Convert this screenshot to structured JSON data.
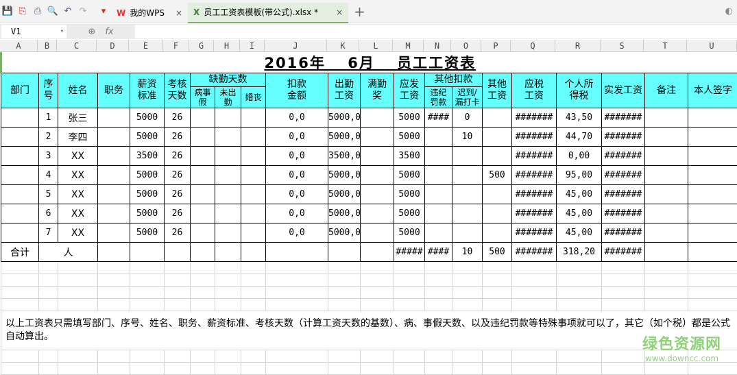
{
  "toolbar": {
    "tabs": [
      {
        "label": "我的WPS"
      },
      {
        "label": "员工工资表模板(带公式).xlsx *"
      }
    ],
    "new_tab": "+",
    "close": "×"
  },
  "formula_bar": {
    "cell_ref": "V1",
    "fx": "fx",
    "value": ""
  },
  "columns": [
    "A",
    "B",
    "C",
    "D",
    "E",
    "F",
    "G",
    "H",
    "I",
    "J",
    "K",
    "L",
    "M",
    "N",
    "O",
    "P",
    "Q",
    "R",
    "S",
    "T",
    "U"
  ],
  "sheet": {
    "title": "2016年　 6月　 员工工资表",
    "headers": {
      "dept": "部门",
      "seq": "序号",
      "name": "姓名",
      "position": "职务",
      "base": "薪资标准",
      "days": "考核天数",
      "absent": "缺勤天数",
      "sick": "病事假",
      "noshow": "未出勤",
      "marriage": "婚丧",
      "deduct": "扣款金额",
      "attend_pay": "出勤工资",
      "full_bonus": "满勤奖",
      "gross": "应发工资",
      "other_deduct": "其他扣款",
      "penalty": "违纪罚款",
      "late": "迟到/漏打卡",
      "other_pay": "其他工资",
      "taxable": "应税工资",
      "tax": "个人所得税",
      "net": "实发工资",
      "remark": "备注",
      "sign": "本人签字"
    },
    "rows": [
      [
        "",
        "1",
        "张三",
        "",
        "5000",
        "26",
        "",
        "",
        "",
        "0,0",
        "5000,0",
        "",
        "5000",
        "####",
        "0",
        "",
        "#######",
        "43,50",
        "#######",
        "",
        ""
      ],
      [
        "",
        "2",
        "李四",
        "",
        "5000",
        "26",
        "",
        "",
        "",
        "0,0",
        "5000,0",
        "",
        "5000",
        "",
        "10",
        "",
        "#######",
        "44,70",
        "#######",
        "",
        ""
      ],
      [
        "",
        "3",
        "XX",
        "",
        "3500",
        "26",
        "",
        "",
        "",
        "0,0",
        "3500,0",
        "",
        "3500",
        "",
        "",
        "",
        "#######",
        "0,00",
        "#######",
        "",
        ""
      ],
      [
        "",
        "4",
        "XX",
        "",
        "5000",
        "26",
        "",
        "",
        "",
        "0,0",
        "5000,0",
        "",
        "5000",
        "",
        "",
        "500",
        "#######",
        "95,00",
        "#######",
        "",
        ""
      ],
      [
        "",
        "5",
        "XX",
        "",
        "5000",
        "26",
        "",
        "",
        "",
        "0,0",
        "5000,0",
        "",
        "5000",
        "",
        "",
        "",
        "#######",
        "45,00",
        "#######",
        "",
        ""
      ],
      [
        "",
        "6",
        "XX",
        "",
        "5000",
        "26",
        "",
        "",
        "",
        "0,0",
        "5000,0",
        "",
        "5000",
        "",
        "",
        "",
        "#######",
        "45,00",
        "#######",
        "",
        ""
      ],
      [
        "",
        "7",
        "XX",
        "",
        "5000",
        "26",
        "",
        "",
        "",
        "0,0",
        "5000,0",
        "",
        "5000",
        "",
        "",
        "",
        "#######",
        "45,00",
        "#######",
        "",
        ""
      ]
    ],
    "total": {
      "label": "合计",
      "people": "人",
      "gross": "#####",
      "penalty": "####",
      "late": "10",
      "other_pay": "500",
      "taxable": "#######",
      "tax": "318,20",
      "net": "#######"
    },
    "note": "以上工资表只需填写部门、序号、姓名、职务、薪资标准、考核天数（计算工资天数的基数）、病、事假天数、以及违纪罚款等特殊事项就可以了，其它（如个税）都是公式自动算出。"
  },
  "watermark": {
    "name": "绿色资源网",
    "url": "www.downcc.com"
  }
}
